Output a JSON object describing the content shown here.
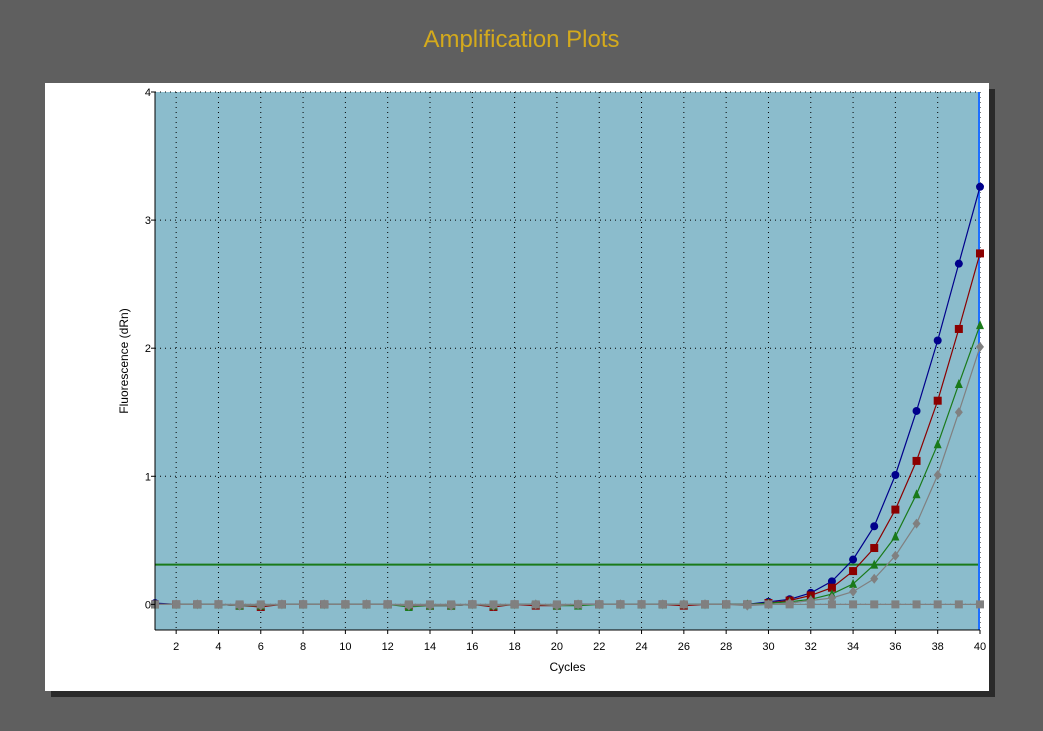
{
  "chart_data": {
    "type": "line",
    "title": "Amplification Plots",
    "xlabel": "Cycles",
    "ylabel": "Fluorescence (dRn)",
    "xlim": [
      1,
      40
    ],
    "ylim": [
      -0.2,
      4
    ],
    "xticks": [
      2,
      4,
      6,
      8,
      10,
      12,
      14,
      16,
      18,
      20,
      22,
      24,
      26,
      28,
      30,
      32,
      34,
      36,
      38,
      40
    ],
    "yticks": [
      0,
      1,
      2,
      3,
      4
    ],
    "grid": true,
    "legend": "none",
    "threshold": 0.31,
    "x": [
      1,
      2,
      3,
      4,
      5,
      6,
      7,
      8,
      9,
      10,
      11,
      12,
      13,
      14,
      15,
      16,
      17,
      18,
      19,
      20,
      21,
      22,
      23,
      24,
      25,
      26,
      27,
      28,
      29,
      30,
      31,
      32,
      33,
      34,
      35,
      36,
      37,
      38,
      39,
      40
    ],
    "series": [
      {
        "color": "#00008b",
        "marker": "circle",
        "values": [
          0.01,
          0.0,
          0.0,
          0.0,
          -0.01,
          -0.01,
          0.0,
          0.0,
          0.0,
          0.0,
          0.0,
          0.0,
          -0.01,
          -0.01,
          -0.01,
          0.0,
          -0.01,
          0.0,
          0.0,
          -0.01,
          0.0,
          0.0,
          0.0,
          0.0,
          0.0,
          0.0,
          0.0,
          0.0,
          0.0,
          0.02,
          0.04,
          0.09,
          0.18,
          0.35,
          0.61,
          1.01,
          1.51,
          2.06,
          2.66,
          3.26
        ]
      },
      {
        "color": "#8b0000",
        "marker": "square",
        "values": [
          0.0,
          0.0,
          0.0,
          0.0,
          -0.01,
          -0.02,
          0.0,
          0.0,
          0.0,
          0.0,
          0.0,
          0.0,
          -0.01,
          -0.01,
          -0.01,
          0.0,
          -0.02,
          0.0,
          -0.01,
          -0.01,
          0.0,
          0.0,
          0.0,
          0.0,
          0.0,
          -0.01,
          0.0,
          0.0,
          0.0,
          0.01,
          0.03,
          0.07,
          0.13,
          0.26,
          0.44,
          0.74,
          1.12,
          1.59,
          2.15,
          2.74
        ]
      },
      {
        "color": "#1a7a1a",
        "marker": "triangle",
        "values": [
          0.0,
          0.0,
          0.0,
          0.0,
          -0.01,
          -0.01,
          0.0,
          0.0,
          0.0,
          0.0,
          0.0,
          0.0,
          -0.02,
          -0.01,
          -0.01,
          0.0,
          -0.01,
          0.0,
          0.0,
          -0.01,
          -0.01,
          0.0,
          0.0,
          0.0,
          0.0,
          0.0,
          0.0,
          0.0,
          0.0,
          0.01,
          0.02,
          0.04,
          0.08,
          0.16,
          0.31,
          0.53,
          0.86,
          1.25,
          1.72,
          2.18
        ]
      },
      {
        "color": "#808080",
        "marker": "diamond",
        "values": [
          0.0,
          0.0,
          0.0,
          0.0,
          -0.01,
          -0.01,
          0.0,
          0.0,
          0.0,
          0.0,
          0.0,
          0.0,
          -0.01,
          -0.01,
          -0.01,
          0.0,
          -0.01,
          0.0,
          0.0,
          -0.01,
          0.0,
          0.0,
          0.0,
          0.0,
          0.0,
          0.0,
          0.0,
          0.0,
          -0.01,
          0.0,
          0.01,
          0.03,
          0.05,
          0.1,
          0.2,
          0.38,
          0.63,
          1.01,
          1.5,
          2.01
        ]
      },
      {
        "color": "#808080",
        "marker": "square",
        "values": [
          0.0,
          0.0,
          0.0,
          0.0,
          0.0,
          0.0,
          0.0,
          0.0,
          0.0,
          0.0,
          0.0,
          0.0,
          0.0,
          0.0,
          0.0,
          0.0,
          0.0,
          0.0,
          0.0,
          0.0,
          0.0,
          0.0,
          0.0,
          0.0,
          0.0,
          0.0,
          0.0,
          0.0,
          0.0,
          0.0,
          0.0,
          0.0,
          0.0,
          0.0,
          0.0,
          0.0,
          0.0,
          0.0,
          0.0,
          0.0
        ]
      }
    ],
    "colors": {
      "plot_background": "#8bbccc",
      "threshold_line": "#1a7a1a",
      "cycle_marker_line": "#1e6fff",
      "title": "#d4aa1c"
    }
  }
}
